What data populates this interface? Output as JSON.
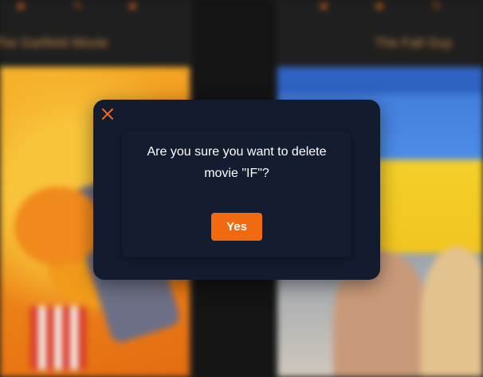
{
  "background": {
    "left_movie_title": "The Garfield Movie",
    "right_movie_title": "The Fall Guy",
    "card_icons": [
      "edit-icon",
      "star-icon",
      "delete-icon"
    ]
  },
  "dialog": {
    "close_icon": "close-icon",
    "message": "Are you sure you want to delete movie \"IF\"?",
    "confirm_label": "Yes",
    "accent_color": "#f26a10",
    "background_color": "#131b2e"
  }
}
